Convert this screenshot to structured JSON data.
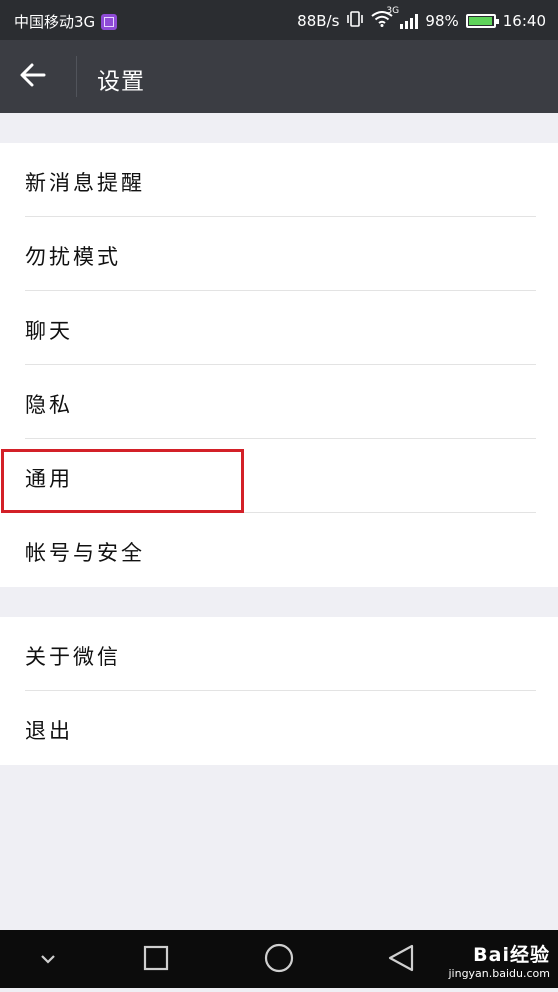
{
  "status_bar": {
    "carrier": "中国移动3G",
    "net_speed": "88B/s",
    "network_type": "3G",
    "battery_percent": "98%",
    "battery_level": 0.98,
    "time": "16:40"
  },
  "app_bar": {
    "title": "设置"
  },
  "settings_groups": [
    {
      "items": [
        {
          "label": "新消息提醒"
        },
        {
          "label": "勿扰模式"
        },
        {
          "label": "聊天"
        },
        {
          "label": "隐私"
        },
        {
          "label": "通用"
        },
        {
          "label": "帐号与安全"
        }
      ]
    },
    {
      "items": [
        {
          "label": "关于微信"
        },
        {
          "label": "退出"
        }
      ]
    }
  ],
  "watermark": {
    "brand": "Bai经验",
    "url": "jingyan.baidu.com"
  },
  "colors": {
    "status_bar": "#2b2d31",
    "app_bar": "#3b3d43",
    "background": "#efeff4",
    "highlight": "#d32028",
    "battery": "#5fd35a"
  }
}
